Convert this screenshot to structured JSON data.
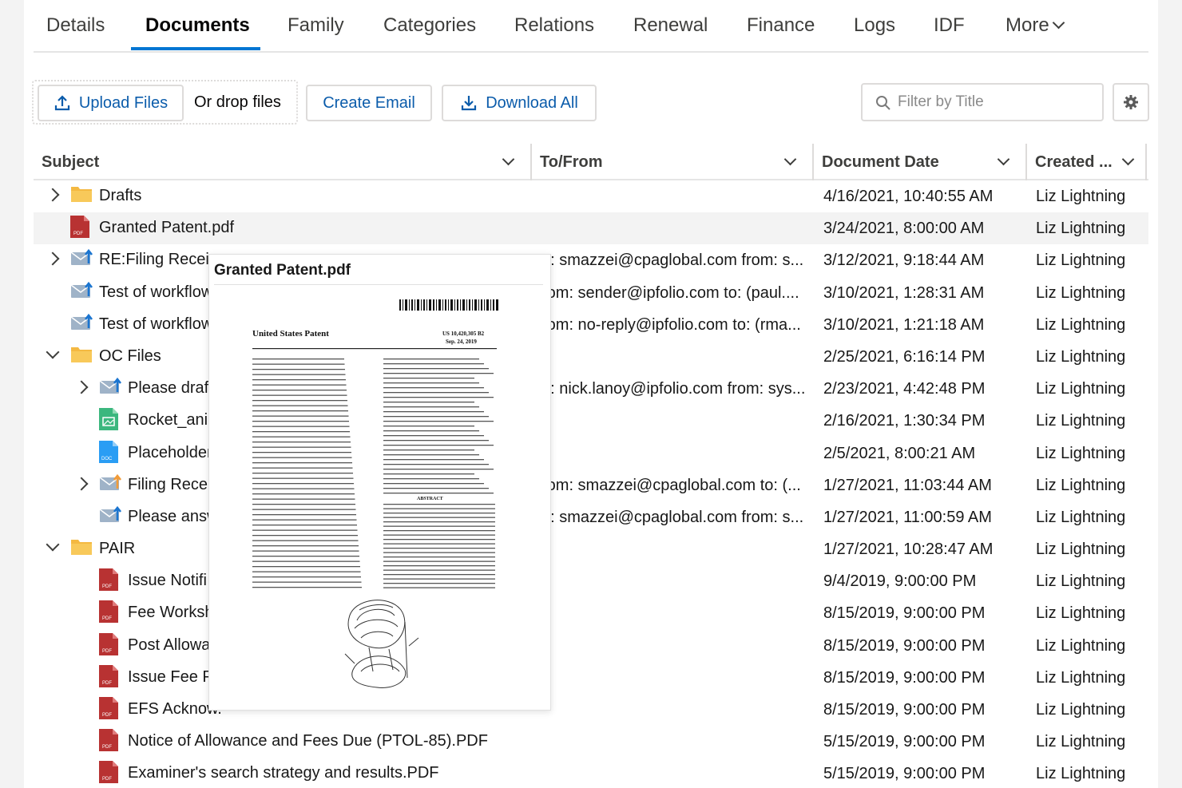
{
  "tabs": [
    {
      "label": "Details"
    },
    {
      "label": "Documents"
    },
    {
      "label": "Family"
    },
    {
      "label": "Categories"
    },
    {
      "label": "Relations"
    },
    {
      "label": "Renewal"
    },
    {
      "label": "Finance"
    },
    {
      "label": "Logs"
    },
    {
      "label": "IDF"
    },
    {
      "label": "More"
    }
  ],
  "toolbar": {
    "upload_label": "Upload Files",
    "drop_label": "Or drop files",
    "create_email_label": "Create Email",
    "download_all_label": "Download All",
    "filter_placeholder": "Filter by Title"
  },
  "columns": {
    "subject": "Subject",
    "to_from": "To/From",
    "document_date": "Document Date",
    "created": "Created ..."
  },
  "rows": [
    {
      "subject": "Drafts",
      "to_from": "",
      "date": "4/16/2021, 10:40:55 AM",
      "created": "Liz Lightning"
    },
    {
      "subject": "Granted Patent.pdf",
      "to_from": "",
      "date": "3/24/2021, 8:00:00 AM",
      "created": "Liz Lightning"
    },
    {
      "subject": "RE:Filing Receip",
      "to_from": "o: smazzei@cpaglobal.com from: s...",
      "date": "3/12/2021, 9:18:44 AM",
      "created": "Liz Lightning"
    },
    {
      "subject": "Test of workflow",
      "to_from": "rom: sender@ipfolio.com to: (paul....",
      "date": "3/10/2021, 1:28:31 AM",
      "created": "Liz Lightning"
    },
    {
      "subject": "Test of workflow",
      "to_from": "rom: no-reply@ipfolio.com to: (rma...",
      "date": "3/10/2021, 1:21:18 AM",
      "created": "Liz Lightning"
    },
    {
      "subject": "OC Files",
      "to_from": "",
      "date": "2/25/2021, 6:16:14 PM",
      "created": "Liz Lightning"
    },
    {
      "subject": "Please draft",
      "to_from": "o: nick.lanoy@ipfolio.com from: sys...",
      "date": "2/23/2021, 4:42:48 PM",
      "created": "Liz Lightning"
    },
    {
      "subject": "Rocket_anir",
      "to_from": "",
      "date": "2/16/2021, 1:30:34 PM",
      "created": "Liz Lightning"
    },
    {
      "subject": "Placeholder",
      "to_from": "",
      "date": "2/5/2021, 8:00:21 AM",
      "created": "Liz Lightning"
    },
    {
      "subject": "Filing Recei",
      "to_from": "rom: smazzei@cpaglobal.com to: (...",
      "date": "1/27/2021, 11:03:44 AM",
      "created": "Liz Lightning"
    },
    {
      "subject": "Please answ",
      "to_from": "o: smazzei@cpaglobal.com from: s...",
      "date": "1/27/2021, 11:00:59 AM",
      "created": "Liz Lightning"
    },
    {
      "subject": "PAIR",
      "to_from": "",
      "date": "1/27/2021, 10:28:47 AM",
      "created": "Liz Lightning"
    },
    {
      "subject": "Issue Notifi",
      "to_from": "",
      "date": "9/4/2019, 9:00:00 PM",
      "created": "Liz Lightning"
    },
    {
      "subject": "Fee Worksh",
      "to_from": "",
      "date": "8/15/2019, 9:00:00 PM",
      "created": "Liz Lightning"
    },
    {
      "subject": "Post Allowa",
      "to_from": "",
      "date": "8/15/2019, 9:00:00 PM",
      "created": "Liz Lightning"
    },
    {
      "subject": "Issue Fee Pa",
      "to_from": "",
      "date": "8/15/2019, 9:00:00 PM",
      "created": "Liz Lightning"
    },
    {
      "subject": "EFS Acknow.",
      "to_from": "",
      "date": "8/15/2019, 9:00:00 PM",
      "created": "Liz Lightning"
    },
    {
      "subject": "Notice of Allowance and Fees Due (PTOL-85).PDF",
      "to_from": "",
      "date": "5/15/2019, 9:00:00 PM",
      "created": "Liz Lightning"
    },
    {
      "subject": "Examiner's search strategy and results.PDF",
      "to_from": "",
      "date": "5/15/2019, 9:00:00 PM",
      "created": "Liz Lightning"
    }
  ],
  "preview": {
    "title": "Granted Patent.pdf",
    "doc_heading": "United States Patent",
    "doc_patent_no": "US 10,420,305 B2",
    "doc_date": "Sep. 24, 2019",
    "doc_abstract_label": "ABSTRACT"
  },
  "icons": {
    "upload": "upload-icon",
    "download": "download-icon",
    "search": "search-icon",
    "gear": "gear-icon",
    "folder": "folder-icon",
    "pdf": "pdf-file-icon",
    "email": "email-icon",
    "image": "image-file-icon",
    "doc": "doc-file-icon"
  },
  "colors": {
    "accent": "#0176d3",
    "link": "#0b5cab",
    "folder": "#f4b942",
    "pdf": "#b83232",
    "image": "#3bb77e",
    "doc": "#2a9df4",
    "email": "#9fb3c8"
  }
}
